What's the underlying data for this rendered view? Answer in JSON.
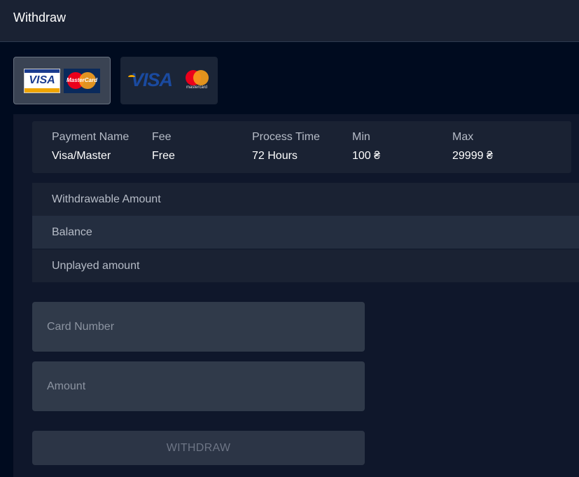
{
  "header": {
    "title": "Withdraw"
  },
  "methods": [
    {
      "name": "Visa/Master",
      "visa_text": "VISA",
      "mc_text": "MasterCard",
      "selected": true
    },
    {
      "visa_text": "VISA",
      "mc_text": "mastercard",
      "selected": false
    }
  ],
  "info": {
    "columns": [
      {
        "header": "Payment Name",
        "value": "Visa/Master"
      },
      {
        "header": "Fee",
        "value": "Free"
      },
      {
        "header": "Process Time",
        "value": "72 Hours"
      },
      {
        "header": "Min",
        "value": "100 ₴"
      },
      {
        "header": "Max",
        "value": "29999 ₴"
      }
    ]
  },
  "amounts": [
    {
      "label": "Withdrawable Amount"
    },
    {
      "label": "Balance"
    },
    {
      "label": "Unplayed amount"
    }
  ],
  "form": {
    "card_placeholder": "Card Number",
    "amount_placeholder": "Amount",
    "submit_label": "WITHDRAW"
  },
  "colors": {
    "background": "#000b1f",
    "header": "#1a2233",
    "panel": "#0f172b",
    "input": "#303a4a",
    "button_disabled": "#2c3546",
    "visa_blue": "#1a4aa0",
    "mc_red": "#eb001b",
    "mc_orange": "#f79e1b"
  }
}
